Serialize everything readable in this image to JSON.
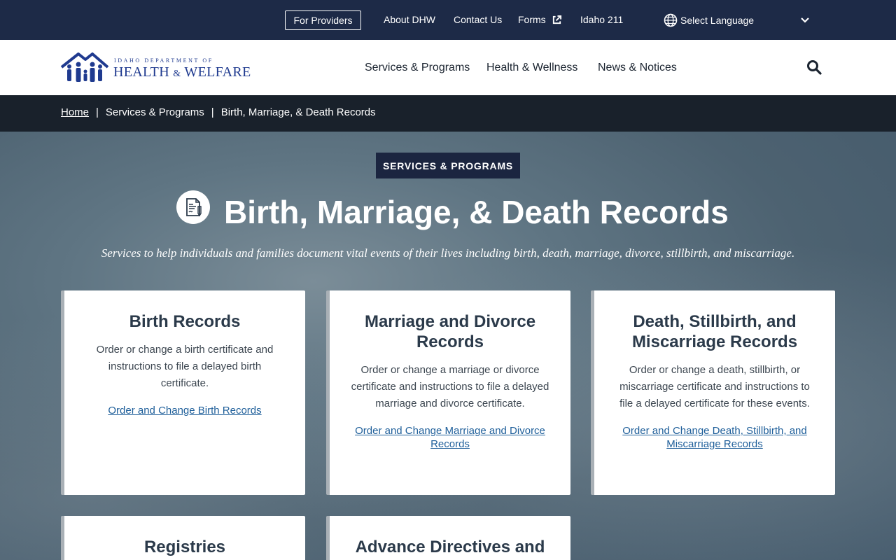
{
  "utility": {
    "providers": "For Providers",
    "about": "About DHW",
    "contact": "Contact Us",
    "forms": "Forms",
    "idaho211": "Idaho 211",
    "language": "Select Language"
  },
  "logo": {
    "line1": "IDAHO DEPARTMENT OF",
    "health": "HEALTH",
    "amp": "&",
    "welfare": "WELFARE"
  },
  "nav": {
    "services": "Services & Programs",
    "health": "Health & Wellness",
    "news": "News & Notices"
  },
  "breadcrumb": {
    "home": "Home",
    "sep": "|",
    "section": "Services & Programs",
    "current": "Birth, Marriage, & Death Records"
  },
  "hero": {
    "category": "SERVICES & PROGRAMS",
    "title": "Birth, Marriage, & Death Records",
    "subtitle": "Services to help individuals and families document vital events of their lives including birth, death, marriage, divorce, stillbirth, and miscarriage."
  },
  "cards": [
    {
      "title": "Birth Records",
      "text": "Order or change a birth certificate and instructions to file a delayed birth certificate.",
      "link": "Order and Change Birth Records"
    },
    {
      "title": "Marriage and Divorce Records",
      "text": "Order or change a marriage or divorce certificate and instructions to file a delayed marriage and divorce certificate.",
      "link": "Order and Change Marriage and Divorce Records"
    },
    {
      "title": "Death, Stillbirth, and Miscarriage Records",
      "text": "Order or change a death, stillbirth, or miscarriage certificate and instructions to file a delayed certificate for these events.",
      "link": "Order and Change Death, Stillbirth, and Miscarriage Records"
    },
    {
      "title": "Registries"
    },
    {
      "title": "Advance Directives and"
    }
  ],
  "colors": {
    "navy": "#1d2a47",
    "breadcrumb_bg": "#19212b",
    "link": "#1f5f9a"
  }
}
